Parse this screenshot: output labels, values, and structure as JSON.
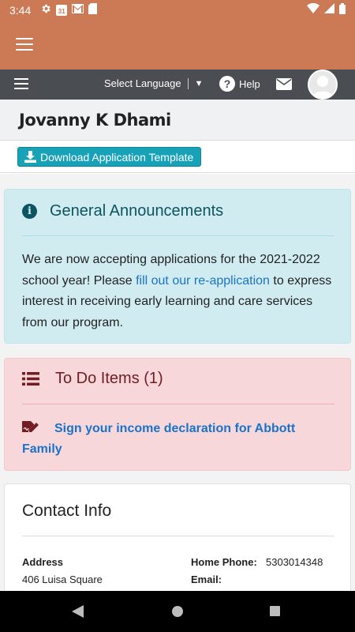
{
  "status_bar": {
    "time": "3:44",
    "left_icons": [
      "settings-icon",
      "calendar-icon",
      "gmail-icon",
      "sd-card-icon"
    ],
    "calendar_day": "31",
    "right_icons": [
      "wifi-icon",
      "signal-icon",
      "battery-icon"
    ]
  },
  "app_bar": {
    "menu_icon": "hamburger-menu-icon",
    "color": "#cc7955"
  },
  "nav_bar": {
    "menu_icon": "hamburger-menu-icon",
    "language_label": "Select Language",
    "language_caret": "▼",
    "help_label": "Help",
    "help_icon": "question-circle-icon",
    "mail_icon": "envelope-icon",
    "avatar_icon": "user-avatar-icon",
    "color": "#4a4d52"
  },
  "profile": {
    "name": "Jovanny K Dhami"
  },
  "download": {
    "label": "Download Application Template",
    "icon": "download-icon",
    "color": "#17a2b8"
  },
  "announcements": {
    "title": "General Announcements",
    "icon": "info-circle-icon",
    "body_before": "We are now accepting applications for the 2021-2022 school year! Please ",
    "link_text": "fill out our re-application",
    "body_after": " to express interest in receiving early learning and care services from our program.",
    "background": "#d1ecf1"
  },
  "todo": {
    "title": "To Do Items (1)",
    "icon": "list-icon",
    "items": [
      {
        "label": "Sign your income declaration for Abbott Family",
        "icon": "signature-icon"
      }
    ],
    "background": "#f8d7da"
  },
  "contact": {
    "title": "Contact Info",
    "address_label": "Address",
    "address_value": "406 Luisa Square",
    "home_phone_label": "Home Phone:",
    "home_phone_value": "5303014348",
    "email_label": "Email:"
  },
  "system_nav": {
    "back_icon": "back-triangle-icon",
    "home_icon": "home-circle-icon",
    "recents_icon": "recents-square-icon"
  }
}
